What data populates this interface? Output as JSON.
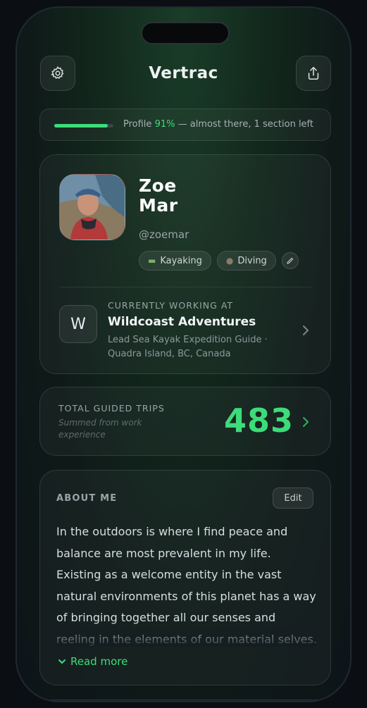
{
  "app": {
    "title": "Vertrac"
  },
  "progress": {
    "prefix": "Profile ",
    "percent_label": "91%",
    "suffix": " — almost there, 1 section left",
    "value": 0.91
  },
  "profile": {
    "name_line1": "Zoe",
    "name_line2": "Mar",
    "handle": "@zoemar",
    "tags": [
      {
        "label": "Kayaking",
        "icon": "kayak-icon"
      },
      {
        "label": "Diving",
        "icon": "diving-icon"
      }
    ]
  },
  "work": {
    "label": "CURRENTLY WORKING AT",
    "logo_letter": "W",
    "company": "Wildcoast Adventures",
    "role_line1": "Lead Sea Kayak Expedition Guide ·",
    "role_line2": "Quadra Island, BC, Canada"
  },
  "trips": {
    "label": "TOTAL GUIDED TRIPS",
    "subtitle": "Summed from work experience",
    "value": "483"
  },
  "about": {
    "label": "ABOUT ME",
    "edit_label": "Edit",
    "text": "In the outdoors is where I find peace and balance are most prevalent in my life. Existing as a welcome entity in the vast natural environments of this planet has a way of bringing together all our senses and reeling in the elements of our material selves. It reminds",
    "read_more": "Read more"
  },
  "colors": {
    "accent": "#3ddc7a",
    "background": "#0b0f14"
  }
}
